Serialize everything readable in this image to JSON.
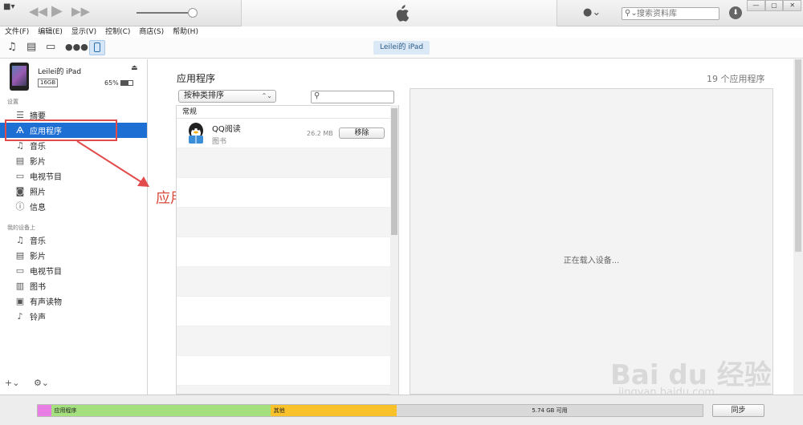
{
  "window": {
    "menu_button": "■▾",
    "search_placeholder": "搜索资料库",
    "window_buttons": [
      "—",
      "▢",
      "✕"
    ]
  },
  "menu": [
    "文件(F)",
    "编辑(E)",
    "显示(V)",
    "控制(C)",
    "商店(S)",
    "帮助(H)"
  ],
  "toolbar": {
    "device_tab": "Leilei的 iPad"
  },
  "device": {
    "name": "Leilei的 iPad",
    "capacity": "16GB",
    "battery_pct": "65%",
    "battery_level": 0.65
  },
  "sidebar": {
    "settings_label": "设置",
    "settings_items": [
      {
        "icon": "list-icon",
        "label": "摘要"
      },
      {
        "icon": "app-store-icon",
        "label": "应用程序"
      },
      {
        "icon": "music-note-icon",
        "label": "音乐"
      },
      {
        "icon": "film-icon",
        "label": "影片"
      },
      {
        "icon": "tv-icon",
        "label": "电视节目"
      },
      {
        "icon": "camera-icon",
        "label": "照片"
      },
      {
        "icon": "info-icon",
        "label": "信息"
      }
    ],
    "mydevice_label": "我的设备上",
    "device_items": [
      {
        "icon": "music-note-icon",
        "label": "音乐"
      },
      {
        "icon": "film-icon",
        "label": "影片"
      },
      {
        "icon": "tv-icon",
        "label": "电视节目"
      },
      {
        "icon": "book-icon",
        "label": "图书"
      },
      {
        "icon": "audiobook-icon",
        "label": "有声读物"
      },
      {
        "icon": "bell-icon",
        "label": "铃声"
      }
    ],
    "add_button": "+⌄",
    "gear_button": "⚙⌄"
  },
  "annotation": {
    "text": "应用程序"
  },
  "main": {
    "title": "应用程序",
    "count": "19 个应用程序",
    "sort_label": "按种类排序",
    "group": "常规",
    "apps": [
      {
        "name": "QQ阅读",
        "category": "图书",
        "size": "26.2 MB",
        "action": "移除"
      }
    ],
    "loading": "正在载入设备..."
  },
  "watermark": {
    "brand": "Bai du 经验",
    "url": "jingyan.baidu.com"
  },
  "capacity_bar": {
    "segments": [
      {
        "label": "",
        "color": "#e97fe5",
        "fraction": 0.02
      },
      {
        "label": "应用程序",
        "color": "#a5e07f",
        "fraction": 0.33
      },
      {
        "label": "其他",
        "color": "#f9c12a",
        "fraction": 0.19
      },
      {
        "label": "5.74 GB 可用",
        "color": "#d9d9d9",
        "fraction": 0.46
      }
    ],
    "sync_label": "同步"
  }
}
